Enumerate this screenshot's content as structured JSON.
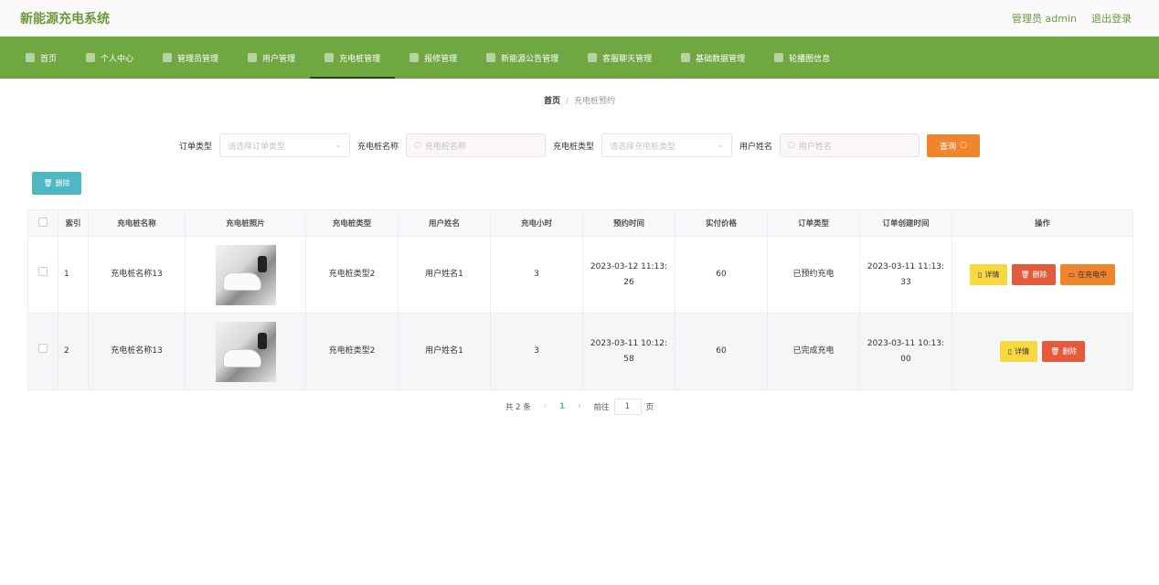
{
  "app": {
    "title": "新能源充电系统",
    "user": "管理员 admin",
    "logout": "退出登录"
  },
  "nav": [
    {
      "label": "首页",
      "icon": "home-icon"
    },
    {
      "label": "个人中心",
      "icon": "user-icon"
    },
    {
      "label": "管理员管理",
      "icon": "admin-icon"
    },
    {
      "label": "用户管理",
      "icon": "users-icon"
    },
    {
      "label": "充电桩管理",
      "icon": "charger-icon",
      "active": true
    },
    {
      "label": "报修管理",
      "icon": "repair-icon"
    },
    {
      "label": "新能源公告管理",
      "icon": "notice-icon"
    },
    {
      "label": "客服聊天管理",
      "icon": "chat-icon"
    },
    {
      "label": "基础数据管理",
      "icon": "data-icon"
    },
    {
      "label": "轮播图信息",
      "icon": "image-icon"
    }
  ],
  "breadcrumb": {
    "home": "首页",
    "sep": "/",
    "current": "充电桩预约"
  },
  "filters": {
    "order_type_label": "订单类型",
    "order_type_placeholder": "请选择订单类型",
    "pile_name_label": "充电桩名称",
    "pile_name_placeholder": "充电桩名称",
    "pile_type_label": "充电桩类型",
    "pile_type_placeholder": "请选择充电桩类型",
    "user_name_label": "用户姓名",
    "user_name_placeholder": "用户姓名",
    "query_label": "查询"
  },
  "toolbar": {
    "delete_label": "删除"
  },
  "table": {
    "headers": [
      "索引",
      "充电桩名称",
      "充电桩照片",
      "充电桩类型",
      "用户姓名",
      "充电小时",
      "预约时间",
      "实付价格",
      "订单类型",
      "订单创建时间",
      "操作"
    ],
    "rows": [
      {
        "index": "1",
        "pile_name": "充电桩名称13",
        "pile_type": "充电桩类型2",
        "user_name": "用户姓名1",
        "hours": "3",
        "reserve_time": "2023-03-12 11:13:26",
        "price": "60",
        "order_type": "已预约充电",
        "created": "2023-03-11 11:13:33",
        "actions": [
          "详情",
          "删除",
          "在充电中"
        ]
      },
      {
        "index": "2",
        "pile_name": "充电桩名称13",
        "pile_type": "充电桩类型2",
        "user_name": "用户姓名1",
        "hours": "3",
        "reserve_time": "2023-03-11 10:12:58",
        "price": "60",
        "order_type": "已完成充电",
        "created": "2023-03-11 10:13:00",
        "actions": [
          "详情",
          "删除"
        ]
      }
    ]
  },
  "pager": {
    "total": "共 2 条",
    "page": "1",
    "goto_prefix": "前往",
    "goto_value": "1",
    "goto_suffix": "页"
  }
}
